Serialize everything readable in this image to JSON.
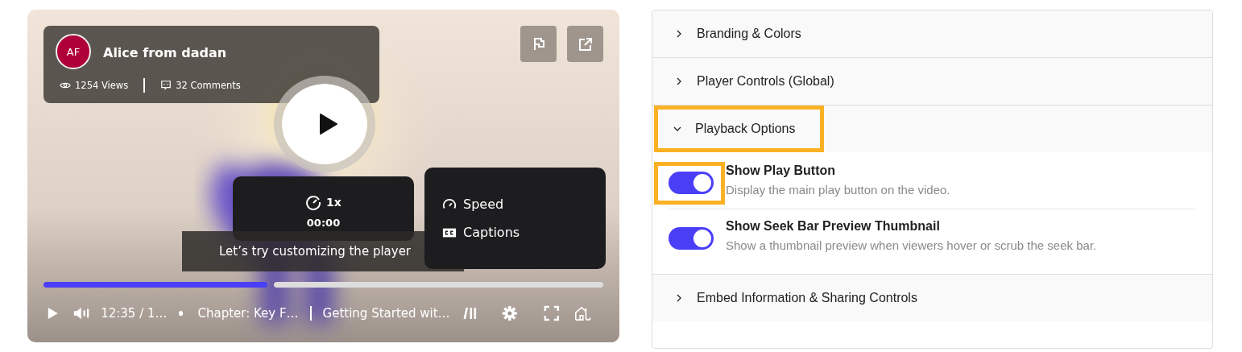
{
  "video": {
    "author": {
      "initials": "AF",
      "name": "Alice from dadan",
      "views": "1254 Views",
      "comments": "32 Comments"
    },
    "speed_tooltip": {
      "speed": "1x",
      "time": "00:00"
    },
    "caption": "Let’s try customizing the player",
    "menu": [
      {
        "kind": "speed",
        "label": "Speed"
      },
      {
        "kind": "captions",
        "label": "Captions"
      }
    ],
    "progress": {
      "level": 0.4
    },
    "controls": {
      "time": "12:35 / 1…",
      "chapter": "Chapter: Key F…",
      "title": "Getting Started wit…"
    }
  },
  "sections": [
    {
      "title": "Branding & Colors",
      "expanded": false,
      "highlighted": false
    },
    {
      "title": "Player Controls (Global)",
      "expanded": false,
      "highlighted": false
    },
    {
      "title": "Playback Options",
      "expanded": true,
      "highlighted": true,
      "settings": [
        {
          "label": "Show Play Button",
          "description": "Display the main play button on the video.",
          "on": true,
          "highlighted": true
        },
        {
          "label": "Show Seek Bar Preview Thumbnail",
          "description": "Show a thumbnail preview when viewers hover or scrub the seek bar.",
          "on": true,
          "highlighted": false
        }
      ]
    },
    {
      "title": "Embed Information & Sharing Controls",
      "expanded": false,
      "highlighted": false
    }
  ]
}
